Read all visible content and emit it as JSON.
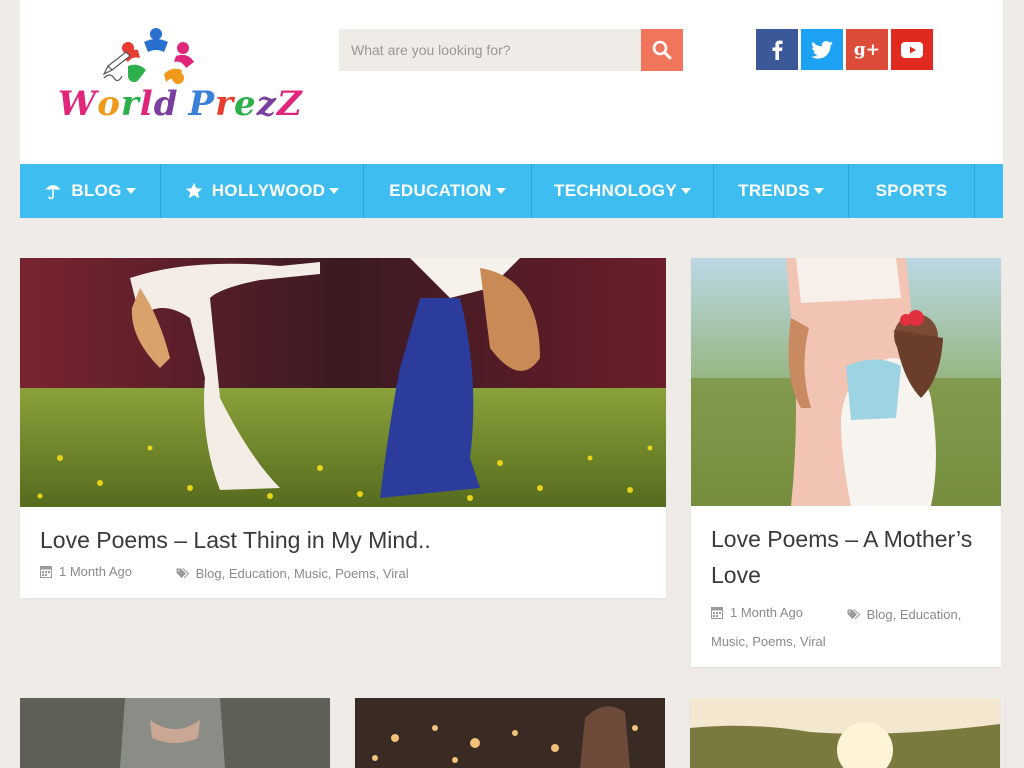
{
  "brand": {
    "logo_text": [
      "W",
      "o",
      "r",
      "l",
      "d",
      " ",
      "P",
      "r",
      "e",
      "z",
      "Z"
    ],
    "logo_colors": [
      "#e0267a",
      "#f09a1c",
      "#2db04b",
      "#e0267a",
      "#7b3fa0",
      "#ffffff",
      "#3a7fd8",
      "#e73c2e",
      "#2db04b",
      "#7b3fa0",
      "#e0267a"
    ]
  },
  "search": {
    "placeholder": "What are you looking for?",
    "icon": "search-icon"
  },
  "social": [
    {
      "name": "facebook",
      "glyph": "f",
      "color": "#3b5998"
    },
    {
      "name": "twitter",
      "glyph": "t",
      "color": "#1da1f2"
    },
    {
      "name": "google-plus",
      "glyph": "g+",
      "color": "#dd4b39"
    },
    {
      "name": "youtube",
      "glyph": "▶",
      "color": "#e02a20"
    }
  ],
  "nav": {
    "accent": "#3ebef0",
    "items": [
      {
        "label": "BLOG",
        "icon": "umbrella-icon",
        "dropdown": true
      },
      {
        "label": "HOLLYWOOD",
        "icon": "star-icon",
        "dropdown": true
      },
      {
        "label": "EDUCATION",
        "icon": "",
        "dropdown": true
      },
      {
        "label": "TECHNOLOGY",
        "icon": "",
        "dropdown": true
      },
      {
        "label": "TRENDS",
        "icon": "",
        "dropdown": true
      },
      {
        "label": "SPORTS",
        "icon": "",
        "dropdown": false
      }
    ]
  },
  "posts": [
    {
      "title": "Love Poems – Last Thing in My Mind..",
      "date": "1 Month Ago",
      "tags": [
        "Blog",
        "Education",
        "Music",
        "Poems",
        "Viral"
      ]
    },
    {
      "title": "Love Poems – A Mother’s Love",
      "date": "1 Month Ago",
      "tags": [
        "Blog",
        "Education",
        "Music",
        "Poems",
        "Viral"
      ]
    }
  ]
}
